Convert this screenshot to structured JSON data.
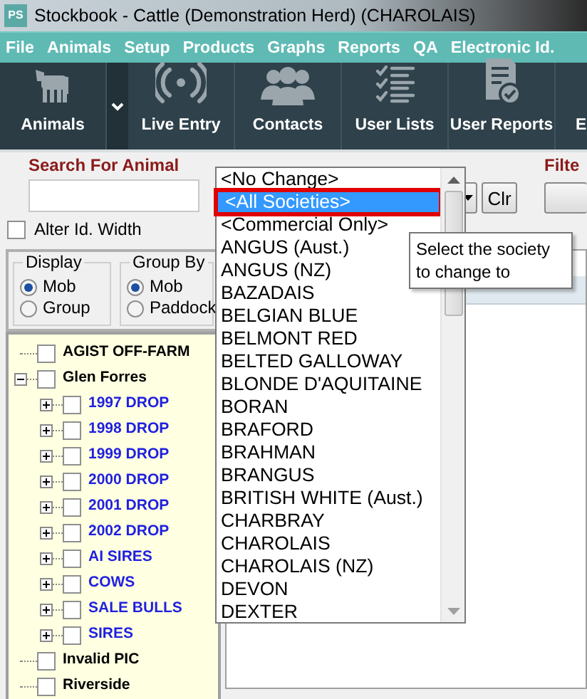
{
  "window": {
    "title": "Stockbook - Cattle (Demonstration Herd) (CHAROLAIS)",
    "app_icon": "PS"
  },
  "menu": [
    {
      "label": "File"
    },
    {
      "label": "Animals"
    },
    {
      "label": "Setup"
    },
    {
      "label": "Products"
    },
    {
      "label": "Graphs"
    },
    {
      "label": "Reports"
    },
    {
      "label": "QA"
    },
    {
      "label": "Electronic Id."
    }
  ],
  "toolbar": [
    {
      "label": "Animals",
      "kind": "cow",
      "selected": true
    },
    {
      "label": "Live Entry",
      "kind": "broadcast",
      "selected": false
    },
    {
      "label": "Contacts",
      "kind": "people",
      "selected": false
    },
    {
      "label": "User Lists",
      "kind": "checklist",
      "selected": false
    },
    {
      "label": "User Reports",
      "kind": "report",
      "selected": false
    },
    {
      "label": "E",
      "kind": "cut",
      "selected": false
    }
  ],
  "search": {
    "label": "Search For Animal"
  },
  "list_filter": {
    "clear_button": "Clr"
  },
  "filter": {
    "label": "Filte"
  },
  "alter_id_width": {
    "label": "Alter Id. Width",
    "checked": false
  },
  "display": {
    "title": "Display",
    "options": [
      {
        "label": "Mob",
        "selected": true
      },
      {
        "label": "Group",
        "selected": false
      }
    ]
  },
  "group_by": {
    "title": "Group By",
    "options": [
      {
        "label": "Mob",
        "selected": true
      },
      {
        "label": "Paddock",
        "selected": false
      }
    ]
  },
  "tree": [
    {
      "label": "AGIST OFF-FARM",
      "checked": false
    },
    {
      "label": "Glen Forres",
      "checked": false,
      "expanded": true,
      "children": [
        {
          "label": "1997 DROP",
          "checked": false,
          "expanded": false
        },
        {
          "label": "1998 DROP",
          "checked": false,
          "expanded": false
        },
        {
          "label": "1999 DROP",
          "checked": false,
          "expanded": false
        },
        {
          "label": "2000 DROP",
          "checked": false,
          "expanded": false
        },
        {
          "label": "2001 DROP",
          "checked": false,
          "expanded": false
        },
        {
          "label": "2002 DROP",
          "checked": false,
          "expanded": false
        },
        {
          "label": "AI SIRES",
          "checked": false,
          "expanded": false
        },
        {
          "label": "COWS",
          "checked": false,
          "expanded": false
        },
        {
          "label": "SALE BULLS",
          "checked": false,
          "expanded": false
        },
        {
          "label": "SIRES",
          "checked": false,
          "expanded": false
        }
      ]
    },
    {
      "label": "Invalid PIC",
      "checked": false
    },
    {
      "label": "Riverside",
      "checked": false
    }
  ],
  "society_dropdown": {
    "items": [
      {
        "label": "<No Change>",
        "selected": false
      },
      {
        "label": "<All Societies>",
        "selected": true
      },
      {
        "label": "<Commercial Only>",
        "selected": false
      },
      {
        "label": "ANGUS (Aust.)",
        "selected": false
      },
      {
        "label": "ANGUS (NZ)",
        "selected": false
      },
      {
        "label": "BAZADAIS",
        "selected": false
      },
      {
        "label": "BELGIAN BLUE",
        "selected": false
      },
      {
        "label": "BELMONT RED",
        "selected": false
      },
      {
        "label": "BELTED GALLOWAY",
        "selected": false
      },
      {
        "label": "BLONDE D'AQUITAINE",
        "selected": false
      },
      {
        "label": "BORAN",
        "selected": false
      },
      {
        "label": "BRAFORD",
        "selected": false
      },
      {
        "label": "BRAHMAN",
        "selected": false
      },
      {
        "label": "BRANGUS",
        "selected": false
      },
      {
        "label": "BRITISH WHITE (Aust.)",
        "selected": false
      },
      {
        "label": "CHARBRAY",
        "selected": false
      },
      {
        "label": "CHAROLAIS",
        "selected": false
      },
      {
        "label": "CHAROLAIS (NZ)",
        "selected": false
      },
      {
        "label": "DEVON",
        "selected": false
      },
      {
        "label": "DEXTER",
        "selected": false
      }
    ]
  },
  "tooltip": "Select the society to change to"
}
